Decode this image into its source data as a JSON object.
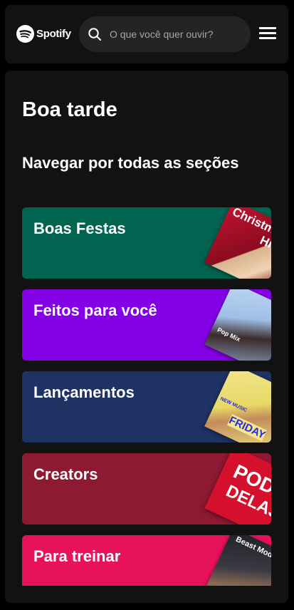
{
  "header": {
    "brand": "Spotify",
    "search_placeholder": "O que você quer ouvir?",
    "icons": [
      "spotify-logo-icon",
      "search-icon",
      "menu-icon"
    ]
  },
  "main": {
    "greeting": "Boa tarde",
    "section_title": "Navegar por todas as seções",
    "cards": [
      {
        "label": "Boas Festas",
        "color": "#006450",
        "art_text": [
          "Christmas",
          "Hits"
        ]
      },
      {
        "label": "Feitos para você",
        "color": "#8400e7",
        "art_text": [
          "Pop Mix"
        ]
      },
      {
        "label": "Lançamentos",
        "color": "#1e3264",
        "art_text": [
          "NEW MUSIC",
          "FRIDAY"
        ]
      },
      {
        "label": "Creators",
        "color": "#8d1932",
        "art_text": [
          "POD",
          "DELAS"
        ]
      },
      {
        "label": "Para treinar",
        "color": "#e8115b",
        "art_text": [
          "Beast Mode"
        ]
      }
    ]
  }
}
